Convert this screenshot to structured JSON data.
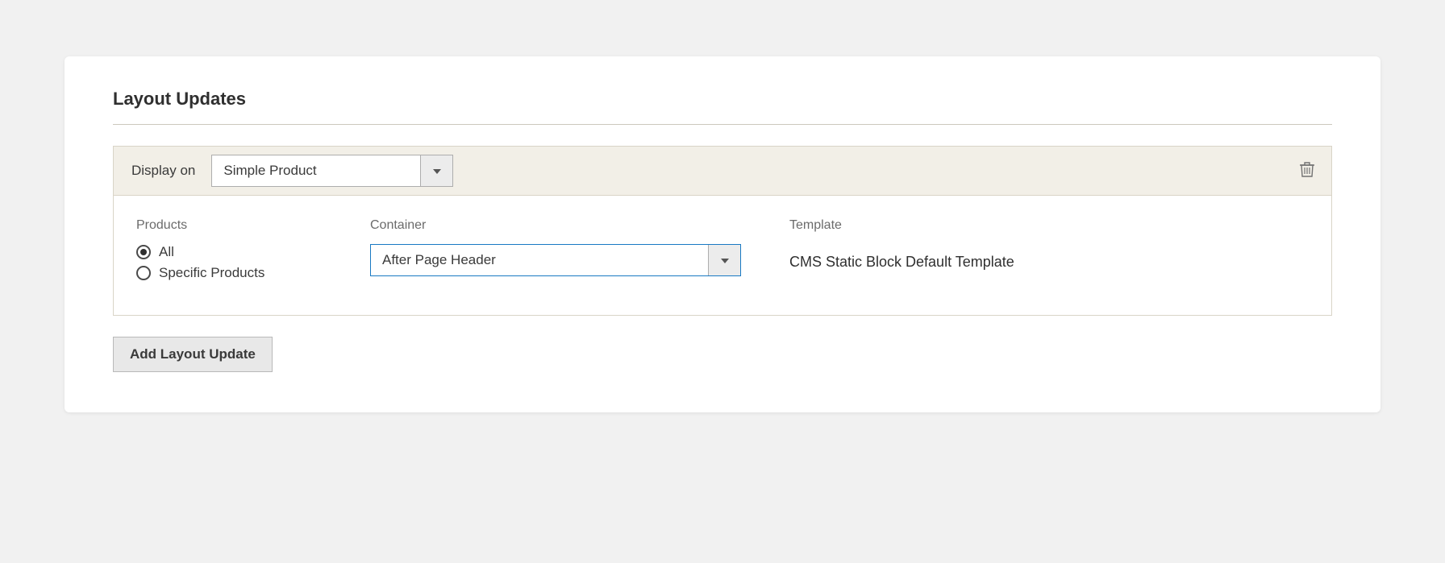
{
  "section": {
    "title": "Layout Updates"
  },
  "update": {
    "displayOnLabel": "Display on",
    "displayOnValue": "Simple Product",
    "products": {
      "label": "Products",
      "options": {
        "all": "All",
        "specific": "Specific Products"
      },
      "selected": "all"
    },
    "container": {
      "label": "Container",
      "value": "After Page Header"
    },
    "template": {
      "label": "Template",
      "value": "CMS Static Block Default Template"
    }
  },
  "buttons": {
    "add": "Add Layout Update"
  }
}
